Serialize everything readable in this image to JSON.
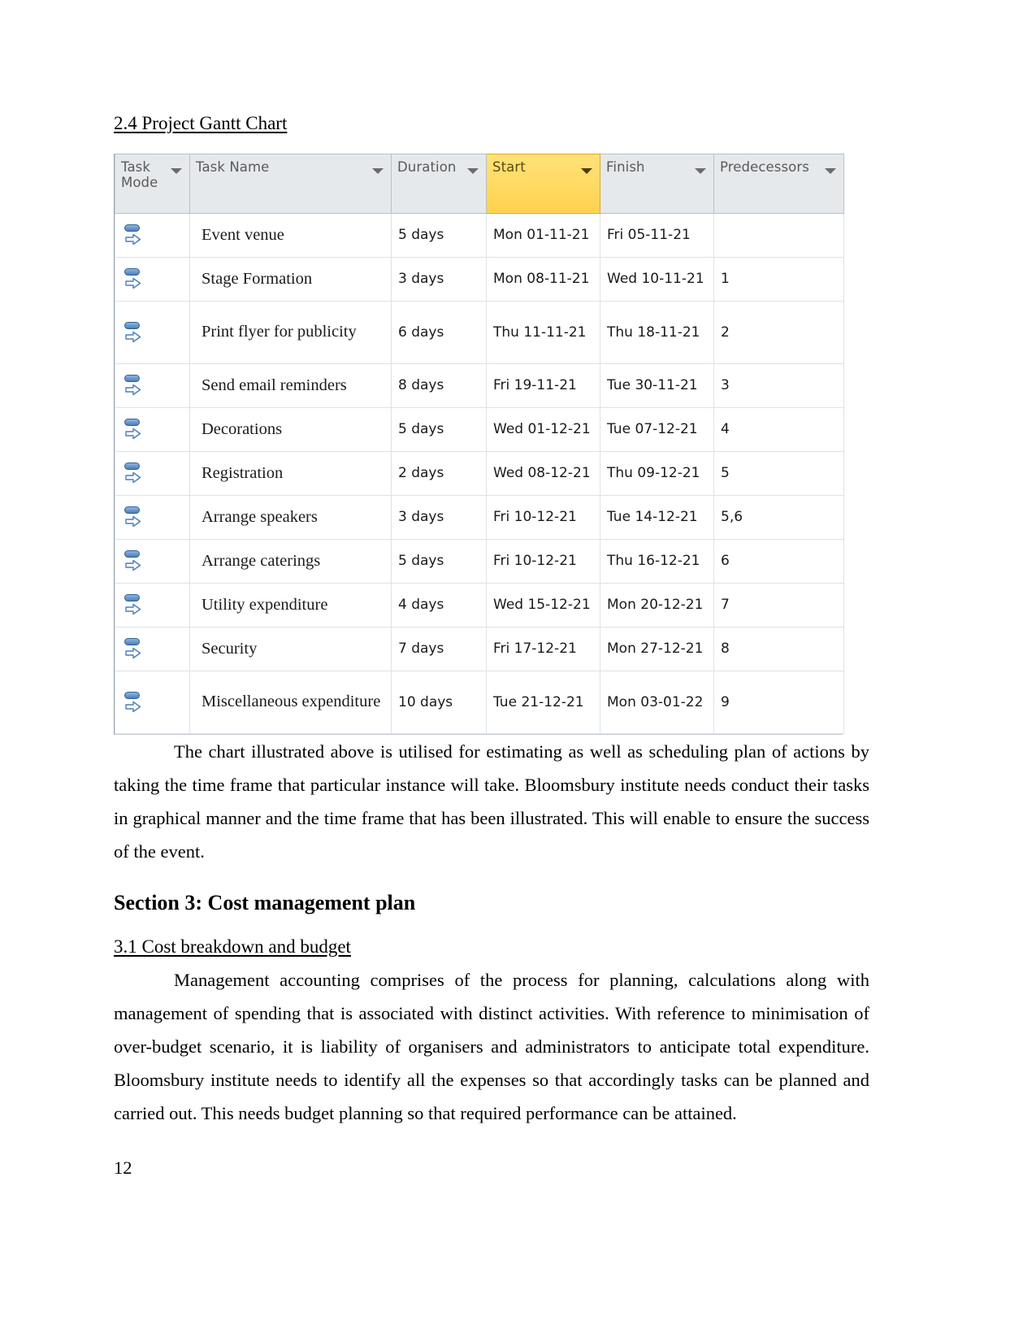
{
  "document": {
    "heading_2_4": "2.4 Project Gantt Chart ",
    "section_3_heading": "Section 3: Cost management plan",
    "heading_3_1": "3.1 Cost breakdown and budget ",
    "paragraph_after_chart": "The chart illustrated above is utilised for estimating as well as scheduling plan of actions by taking the time frame that particular instance will take. Bloomsbury institute needs conduct their tasks in graphical manner and the time frame that has been illustrated. This will enable to ensure the success of the event.",
    "paragraph_cost": "Management accounting comprises of the process for planning, calculations along with management of spending that is associated with distinct activities. With reference to minimisation of over-budget scenario, it is liability of organisers and administrators to anticipate total expenditure. Bloomsbury institute needs to identify all the expenses so that accordingly tasks can be planned and carried out. This needs budget planning so that required performance can be attained.",
    "page_number": "12"
  },
  "gantt_table": {
    "columns": [
      {
        "key": "task_mode",
        "label": "Task Mode",
        "highlighted": false,
        "filter_icon": "filter-dropdown-icon"
      },
      {
        "key": "task_name",
        "label": "Task Name",
        "highlighted": false,
        "filter_icon": "filter-dropdown-icon"
      },
      {
        "key": "duration",
        "label": "Duration",
        "highlighted": false,
        "filter_icon": "filter-dropdown-icon"
      },
      {
        "key": "start",
        "label": "Start",
        "highlighted": true,
        "filter_icon": "filter-dropdown-icon"
      },
      {
        "key": "finish",
        "label": "Finish",
        "highlighted": false,
        "filter_icon": "filter-dropdown-icon"
      },
      {
        "key": "predecessors",
        "label": "Predecessors",
        "highlighted": false,
        "filter_icon": "filter-dropdown-icon"
      }
    ],
    "header_highlight_color": "#ffd95b",
    "selection_color": "#e3ecf8",
    "task_mode_icon": "auto-scheduled-icon",
    "rows": [
      {
        "mode_icon": "auto-scheduled-icon",
        "task_name": "Event venue",
        "duration": "5 days",
        "start": "Mon 01-11-21",
        "finish": "Fri 05-11-21",
        "predecessors": "",
        "sel_duration": false,
        "sel_start": false,
        "sel_finish": false
      },
      {
        "mode_icon": "auto-scheduled-icon",
        "task_name": "Stage Formation",
        "duration": "3 days",
        "start": "Mon 08-11-21",
        "finish": "Wed 10-11-21",
        "predecessors": "1",
        "sel_duration": false,
        "sel_start": false,
        "sel_finish": false
      },
      {
        "mode_icon": "auto-scheduled-icon",
        "task_name": "Print flyer for publicity",
        "duration": "6 days",
        "start": "Thu 11-11-21",
        "finish": "Thu 18-11-21",
        "predecessors": "2",
        "sel_duration": false,
        "sel_start": false,
        "sel_finish": false
      },
      {
        "mode_icon": "auto-scheduled-icon",
        "task_name": "Send email reminders",
        "duration": "8 days",
        "start": "Fri 19-11-21",
        "finish": "Tue 30-11-21",
        "predecessors": "3",
        "sel_duration": true,
        "sel_start": false,
        "sel_finish": true
      },
      {
        "mode_icon": "auto-scheduled-icon",
        "task_name": "Decorations",
        "duration": "5 days",
        "start": "Wed 01-12-21",
        "finish": "Tue 07-12-21",
        "predecessors": "4",
        "sel_duration": false,
        "sel_start": true,
        "sel_finish": true
      },
      {
        "mode_icon": "auto-scheduled-icon",
        "task_name": "Registration",
        "duration": "2 days",
        "start": "Wed 08-12-21",
        "finish": "Thu 09-12-21",
        "predecessors": "5",
        "sel_duration": false,
        "sel_start": true,
        "sel_finish": true
      },
      {
        "mode_icon": "auto-scheduled-icon",
        "task_name": "Arrange speakers",
        "duration": "3 days",
        "start": "Fri 10-12-21",
        "finish": "Tue 14-12-21",
        "predecessors": "5,6",
        "sel_duration": false,
        "sel_start": true,
        "sel_finish": true
      },
      {
        "mode_icon": "auto-scheduled-icon",
        "task_name": "Arrange caterings",
        "duration": "5 days",
        "start": "Fri 10-12-21",
        "finish": "Thu 16-12-21",
        "predecessors": "6",
        "sel_duration": false,
        "sel_start": true,
        "sel_finish": true
      },
      {
        "mode_icon": "auto-scheduled-icon",
        "task_name": "Utility expenditure",
        "duration": "4 days",
        "start": "Wed 15-12-21",
        "finish": "Mon 20-12-21",
        "predecessors": "7",
        "sel_duration": false,
        "sel_start": true,
        "sel_finish": true
      },
      {
        "mode_icon": "auto-scheduled-icon",
        "task_name": "Security",
        "duration": "7 days",
        "start": "Fri 17-12-21",
        "finish": "Mon 27-12-21",
        "predecessors": "8",
        "sel_duration": false,
        "sel_start": true,
        "sel_finish": true
      },
      {
        "mode_icon": "auto-scheduled-icon",
        "task_name": "Miscellaneous expenditure",
        "duration": "10 days",
        "start": "Tue 21-12-21",
        "finish": "Mon 03-01-22",
        "predecessors": "9",
        "sel_duration": false,
        "sel_start": true,
        "sel_finish": true
      }
    ]
  }
}
